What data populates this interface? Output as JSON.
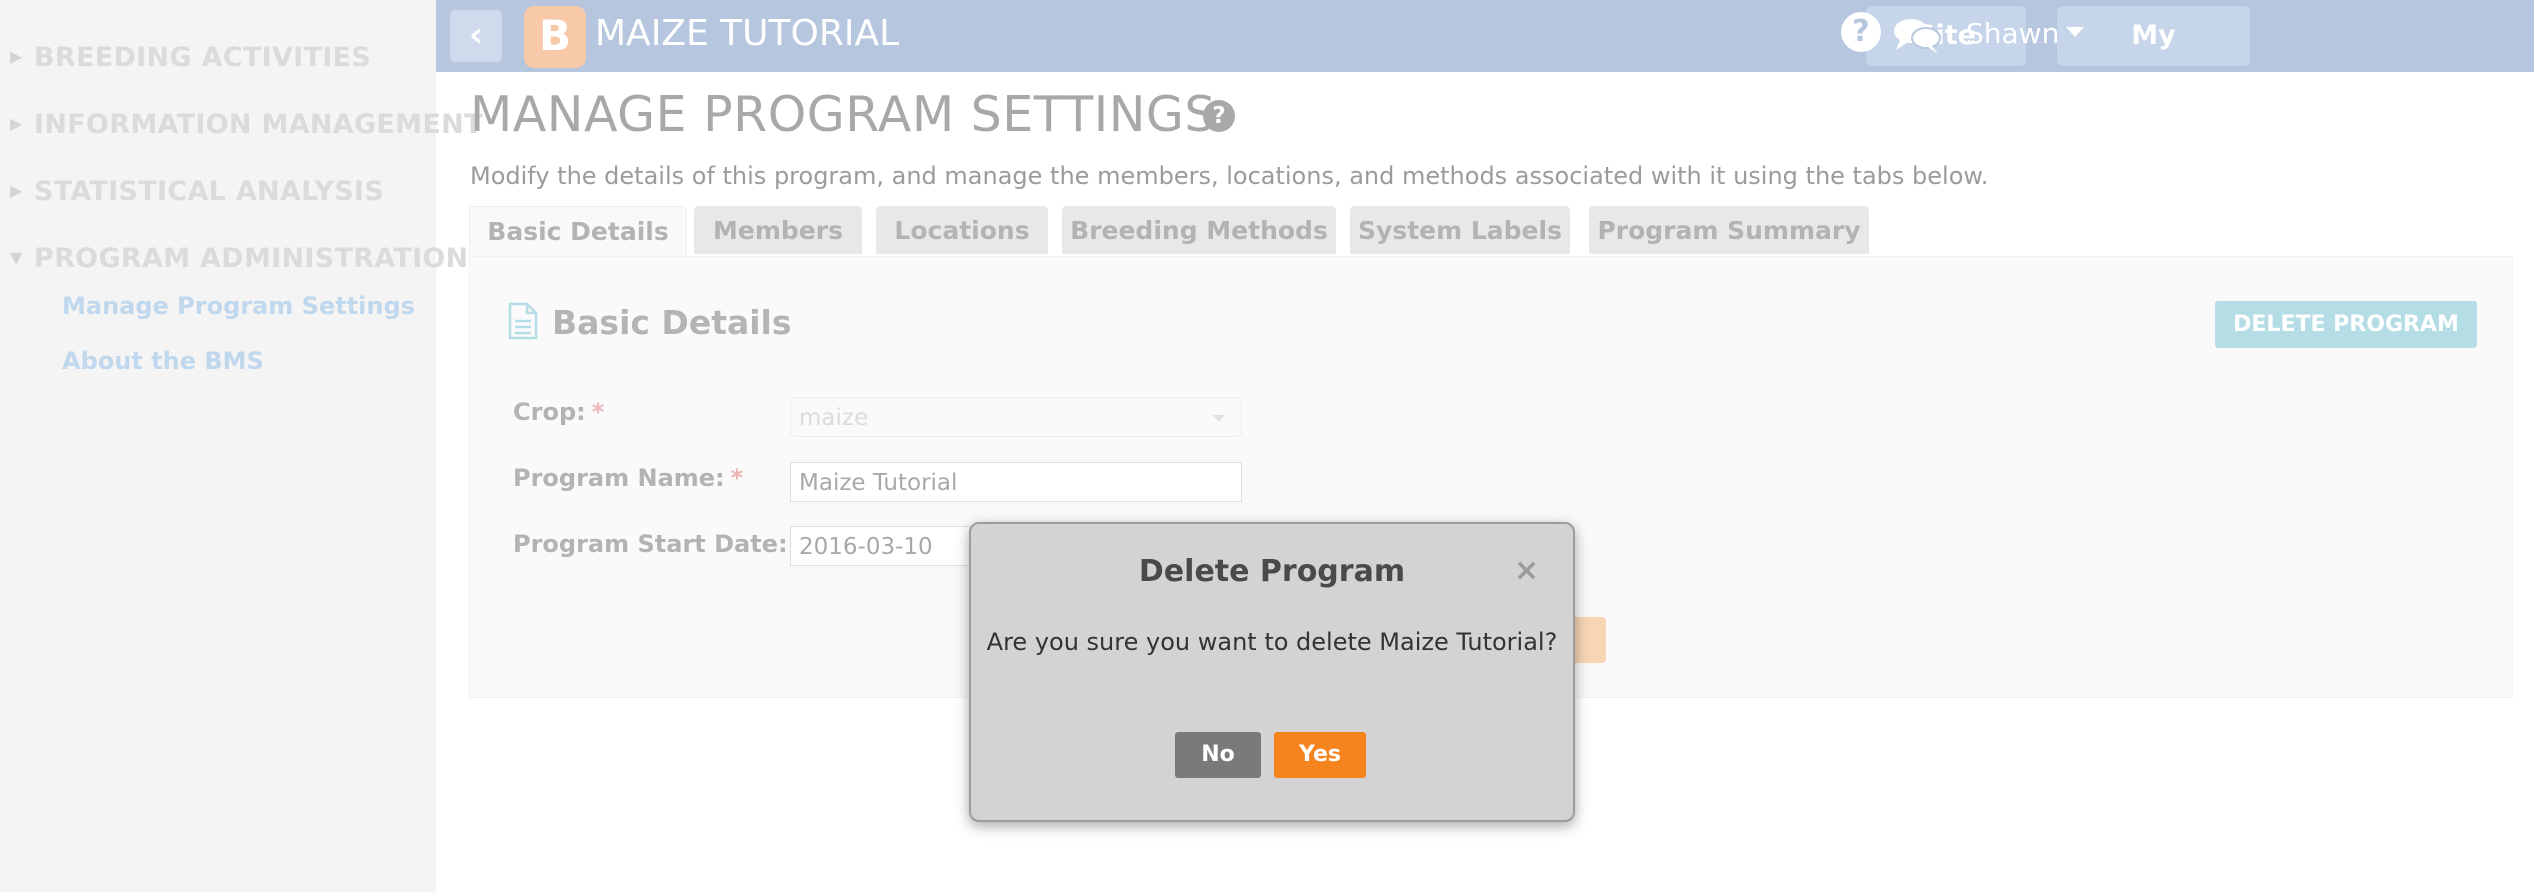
{
  "sidebar": {
    "sections": [
      {
        "label": "BREEDING ACTIVITIES",
        "expanded": false
      },
      {
        "label": "INFORMATION MANAGEMENT",
        "expanded": false
      },
      {
        "label": "STATISTICAL ANALYSIS",
        "expanded": false
      },
      {
        "label": "PROGRAM ADMINISTRATION",
        "expanded": true
      }
    ],
    "links": [
      "Manage Program Settings",
      "About the BMS"
    ]
  },
  "header": {
    "logo": "B",
    "title": "MAIZE TUTORIAL",
    "site_admin": "Site Admin",
    "my_programs": "My Programs",
    "help": "?",
    "user": "Shawn"
  },
  "page": {
    "title": "MANAGE PROGRAM SETTINGS",
    "help": "?",
    "description": "Modify the details of this program, and manage the members, locations, and methods associated with it using the tabs below."
  },
  "tabs": [
    "Basic Details",
    "Members",
    "Locations",
    "Breeding Methods",
    "System Labels",
    "Program Summary"
  ],
  "basic_details": {
    "heading": "Basic Details",
    "delete_button": "DELETE PROGRAM",
    "crop_label": "Crop:",
    "crop_value": "maize",
    "program_name_label": "Program Name:",
    "program_name_value": "Maize Tutorial",
    "start_date_label": "Program Start Date:",
    "start_date_value": "2016-03-10",
    "required_mark": "*"
  },
  "dialog": {
    "title": "Delete Program",
    "close": "×",
    "message": "Are you sure you want to delete Maize Tutorial?",
    "no": "No",
    "yes": "Yes"
  },
  "colors": {
    "header": "#8fa8cd",
    "sidebar_link": "#9fc3e4",
    "delete_program": "#8ecbd9",
    "yes_button": "#f5841f",
    "no_button": "#7a7a7a"
  }
}
